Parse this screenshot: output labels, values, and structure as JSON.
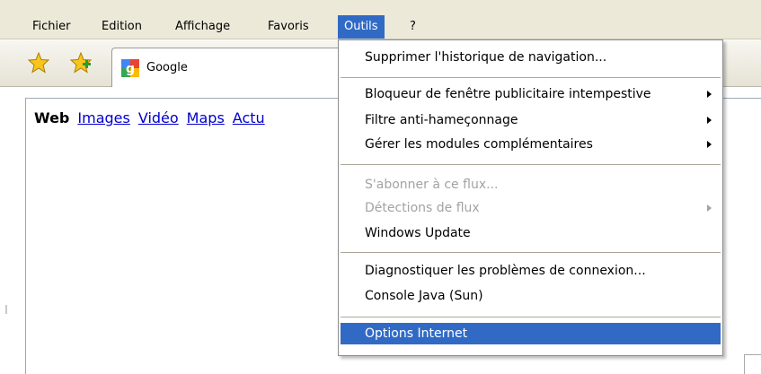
{
  "menubar": {
    "items": [
      {
        "label": "Fichier"
      },
      {
        "label": "Edition"
      },
      {
        "label": "Affichage"
      },
      {
        "label": "Favoris"
      },
      {
        "label": "Outils"
      },
      {
        "label": "?"
      }
    ],
    "active_item": "Outils"
  },
  "toolbar": {
    "favorites_icon": "favorites-star-icon",
    "add_favorites_icon": "add-favorites-star-icon",
    "tab": {
      "title": "Google",
      "icon": "google-favicon"
    }
  },
  "page": {
    "search_nav": [
      "Web",
      "Images",
      "Vidéo",
      "Maps",
      "Actu"
    ]
  },
  "tools_menu": {
    "items": [
      {
        "label": "Supprimer l'historique de navigation...",
        "disabled": false
      },
      {
        "label": "Bloqueur de fenêtre publicitaire intempestive",
        "submenu": true
      },
      {
        "label": "Filtre anti-hameçonnage",
        "submenu": true
      },
      {
        "label": "Gérer les modules complémentaires",
        "submenu": true
      },
      {
        "label": "S'abonner à ce flux...",
        "disabled": true
      },
      {
        "label": "Détections de flux",
        "disabled": true,
        "submenu": true
      },
      {
        "label": "Windows Update"
      },
      {
        "label": "Diagnostiquer les problèmes de connexion..."
      },
      {
        "label": "Console Java (Sun)"
      },
      {
        "label": "Options Internet",
        "highlighted": true
      }
    ]
  },
  "colors": {
    "menubar_bg": "#ece9d8",
    "highlight": "#316ac5",
    "link": "#0000cc",
    "disabled_text": "#a3a3a3"
  }
}
